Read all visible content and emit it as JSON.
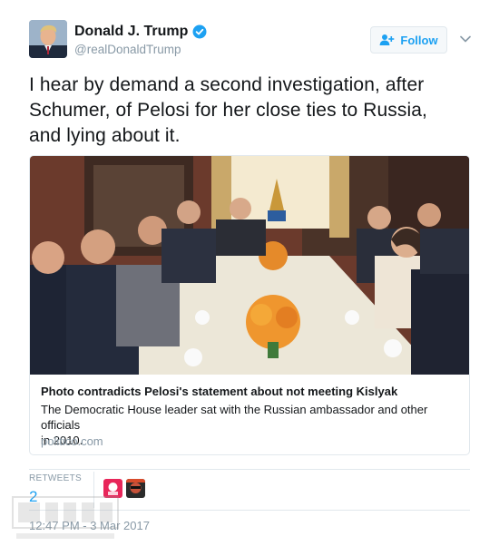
{
  "author": {
    "name": "Donald J. Trump",
    "handle": "@realDonaldTrump"
  },
  "follow_button": {
    "label": "Follow"
  },
  "tweet": {
    "line1": "I hear by demand a second investigation, after",
    "line2": "Schumer, of Pelosi for her close ties to Russia,",
    "line3": "and lying about it."
  },
  "card": {
    "title": "Photo contradicts Pelosi's statement about not meeting Kislyak",
    "desc_line1": "The Democratic House leader sat with the Russian ambassador and other officials",
    "desc_line2": "in 2010.",
    "domain": "politico.com"
  },
  "stats": {
    "retweets_label": "RETWEETS",
    "retweets_count": "2"
  },
  "timestamp": "12:47 PM - 3 Mar 2017",
  "colors": {
    "accent": "#1da1f2",
    "text": "#14171a",
    "muted": "#8899a6",
    "border": "#e1e8ed"
  },
  "icons": [
    "verified-icon",
    "follow-icon",
    "chevron-down-icon"
  ]
}
